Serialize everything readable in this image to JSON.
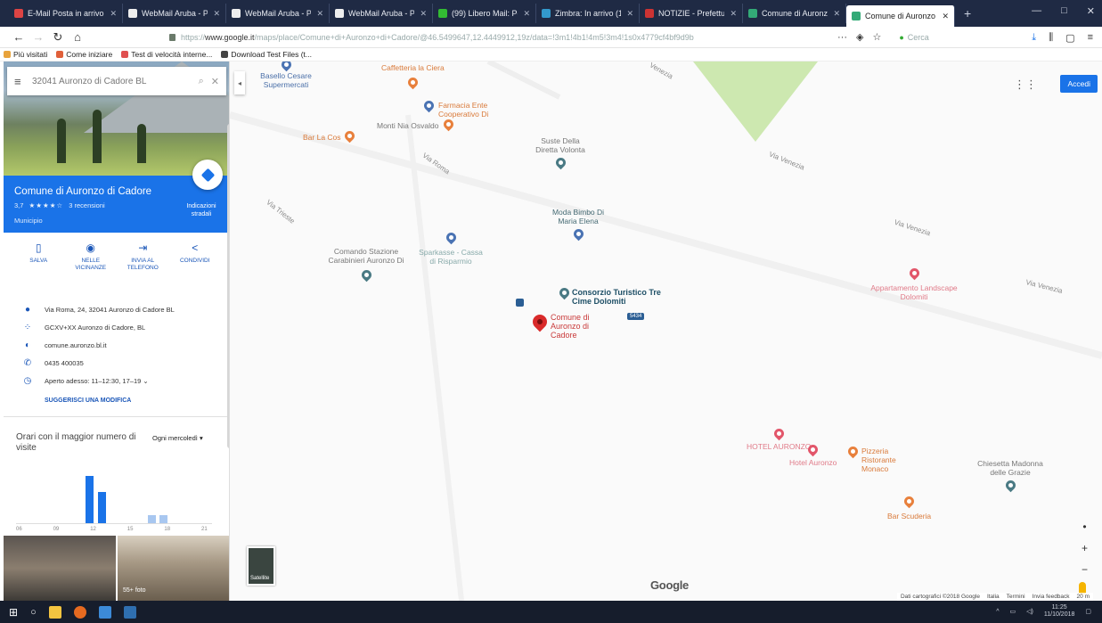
{
  "browser": {
    "tabs": [
      {
        "label": "E-Mail Posta in arrivo",
        "color": "#d44"
      },
      {
        "label": "WebMail Aruba - Posta",
        "color": "#eee"
      },
      {
        "label": "WebMail Aruba - Posta",
        "color": "#eee"
      },
      {
        "label": "WebMail Aruba - Posta",
        "color": "#eee"
      },
      {
        "label": "(99) Libero Mail: Posta",
        "color": "#3b3"
      },
      {
        "label": "Zimbra: In arrivo (124)",
        "color": "#39c"
      },
      {
        "label": "NOTIZIE - Prefettura",
        "color": "#c33"
      },
      {
        "label": "Comune di Auronzo di",
        "color": "#3a7"
      },
      {
        "label": "Comune di Auronzo",
        "color": "#3a7"
      }
    ],
    "new_tab": "+",
    "url_domain": "www.google.it",
    "url_rest": "/maps/place/Comune+di+Auronzo+di+Cadore/@46.5499647,12.4449912,19z/data=!3m1!4b1!4m5!3m4!1s0x4779cf4bf9d9b",
    "url_prefix": "https://",
    "search_placeholder": "Cerca",
    "bookmarks": [
      {
        "label": "Più visitati",
        "color": "#e8a33c"
      },
      {
        "label": "Come iniziare",
        "color": "#e0603a"
      },
      {
        "label": "Test di velocità interne...",
        "color": "#e05050"
      },
      {
        "label": "Download Test Files (t...",
        "color": "#444"
      }
    ]
  },
  "search": {
    "value": "32041 Auronzo di Cadore BL"
  },
  "place": {
    "name": "Comune di Auronzo di Cadore",
    "rating": "3,7",
    "stars": "★★★★☆",
    "reviews": "3 recensioni",
    "category": "Municipio",
    "directions_label": "Indicazioni stradali"
  },
  "actions": [
    {
      "icon": "bookmark-icon",
      "glyph": "▯",
      "label": "SALVA"
    },
    {
      "icon": "nearby-icon",
      "glyph": "◉",
      "label": "NELLE VICINANZE"
    },
    {
      "icon": "phone-send-icon",
      "glyph": "⇥",
      "label": "INVIA AL TELEFONO"
    },
    {
      "icon": "share-icon",
      "glyph": "<",
      "label": "CONDIVIDI"
    }
  ],
  "info": [
    {
      "icon": "location-icon",
      "glyph": "●",
      "text": "Via Roma, 24, 32041 Auronzo di Cadore BL"
    },
    {
      "icon": "plus-code-icon",
      "glyph": "⁘",
      "text": "GCXV+XX Auronzo di Cadore, BL"
    },
    {
      "icon": "web-icon",
      "glyph": "◐",
      "text": "comune.auronzo.bl.it"
    },
    {
      "icon": "phone-icon",
      "glyph": "✆",
      "text": "0435 400035"
    },
    {
      "icon": "clock-icon",
      "glyph": "◷",
      "text": "Aperto adesso:  11–12:30, 17–19  ⌄"
    }
  ],
  "suggest_edit": "SUGGERISCI UNA MODIFICA",
  "popular_times": {
    "title": "Orari con il maggior numero di visite",
    "day": "Ogni mercoledì ▾",
    "hours": [
      "06",
      "09",
      "12",
      "15",
      "18",
      "21"
    ],
    "bars": [
      {
        "hour": 11.5,
        "level": 0.86,
        "light": false
      },
      {
        "hour": 12.5,
        "level": 0.56,
        "light": false
      },
      {
        "hour": 16.5,
        "level": 0.14,
        "light": true
      },
      {
        "hour": 17.5,
        "level": 0.14,
        "light": true
      }
    ]
  },
  "photos": {
    "count_label": "55+ foto"
  },
  "map": {
    "streets": [
      "Venezia",
      "Via Roma",
      "Via Trieste",
      "Via Venezia",
      "Via Venezia",
      "Via Venezia"
    ],
    "pois": {
      "supermercati": "Basello Cesare Supermercati",
      "caffetteria": "Caffetteria la Ciera",
      "farmacia": "Farmacia Ente Cooperativo Di",
      "monti": "Monti Nia Osvaldo",
      "bar_la_cos": "Bar La Cos",
      "suste": "Suste Della Diretta Volonta",
      "moda": "Moda Bimbo Di Maria Elena",
      "carabinieri": "Comando Stazione Carabinieri Auronzo Di",
      "sparkasse": "Sparkasse - Cassa di Risparmio",
      "landscape": "Appartamento Landscape Dolomiti",
      "hotel": "HOTEL AURONZO",
      "hotel_sub": "Hotel Auronzo",
      "pizzeria": "Pizzeria Ristorante Monaco",
      "chiesetta": "Chiesetta Madonna delle Grazie",
      "scuderia": "Bar Scuderia"
    },
    "consorzio": "Consorzio Turistico Tre Cime Dolomiti",
    "main_pin": "Comune di Auronzo di Cadore",
    "badge": "5434",
    "signin": "Accedi",
    "satellite": "Satellite",
    "logo": "Google",
    "attribution": [
      "Dati cartografici ©2018 Google",
      "Italia",
      "Termini",
      "Invia feedback",
      "20 m"
    ]
  },
  "taskbar": {
    "time": "11:25",
    "date": "11/10/2018"
  }
}
